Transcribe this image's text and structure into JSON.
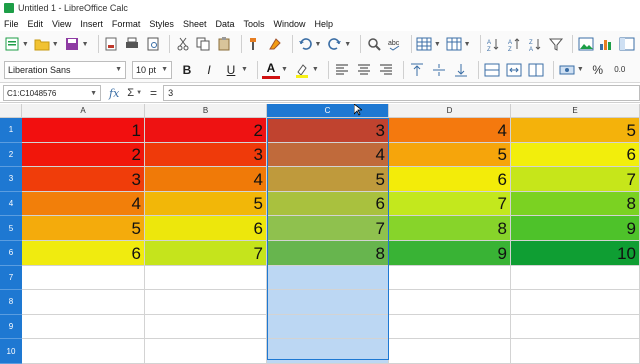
{
  "window": {
    "title": "Untitled 1 - LibreOffice Calc"
  },
  "menu": [
    "File",
    "Edit",
    "View",
    "Insert",
    "Format",
    "Styles",
    "Sheet",
    "Data",
    "Tools",
    "Window",
    "Help"
  ],
  "toolbar": {
    "font_name": "Liberation Sans",
    "font_size": "10 pt",
    "bold": "B",
    "italic": "I",
    "underline": "U",
    "font_color": "A",
    "currency": "$",
    "percent": "%",
    "decimal": "0.0"
  },
  "formula_bar": {
    "name_box": "C1:C1048576",
    "fx": "fx",
    "sigma": "Σ",
    "equals": "=",
    "value": "3"
  },
  "sheet": {
    "columns": [
      "A",
      "B",
      "C",
      "D",
      "E"
    ],
    "selected_column": "C",
    "rows": [
      "1",
      "2",
      "3",
      "4",
      "5",
      "6",
      "7",
      "8",
      "9",
      "10"
    ],
    "data": [
      [
        "1",
        "2",
        "3",
        "4",
        "5"
      ],
      [
        "2",
        "3",
        "4",
        "5",
        "6"
      ],
      [
        "3",
        "4",
        "5",
        "6",
        "7"
      ],
      [
        "4",
        "5",
        "6",
        "7",
        "8"
      ],
      [
        "5",
        "6",
        "7",
        "8",
        "9"
      ],
      [
        "6",
        "7",
        "8",
        "9",
        "10"
      ]
    ],
    "colors": [
      [
        "#f20f0f",
        "#ee1212",
        "#c0432f",
        "#f4790e",
        "#f4b20b"
      ],
      [
        "#f1160b",
        "#ef3a0a",
        "#c06a3b",
        "#f6a50b",
        "#f2ee0c"
      ],
      [
        "#f03d0a",
        "#f07a08",
        "#bf9a3c",
        "#f3ec09",
        "#c6e61a"
      ],
      [
        "#f27f0a",
        "#f2b708",
        "#a9c13e",
        "#c3e81d",
        "#7bd222"
      ],
      [
        "#f4ab0c",
        "#ede70c",
        "#8fc14e",
        "#87d42a",
        "#4ec22a"
      ],
      [
        "#f0eb0f",
        "#c5e41c",
        "#67b54e",
        "#39b335",
        "#0f9e33"
      ]
    ]
  }
}
